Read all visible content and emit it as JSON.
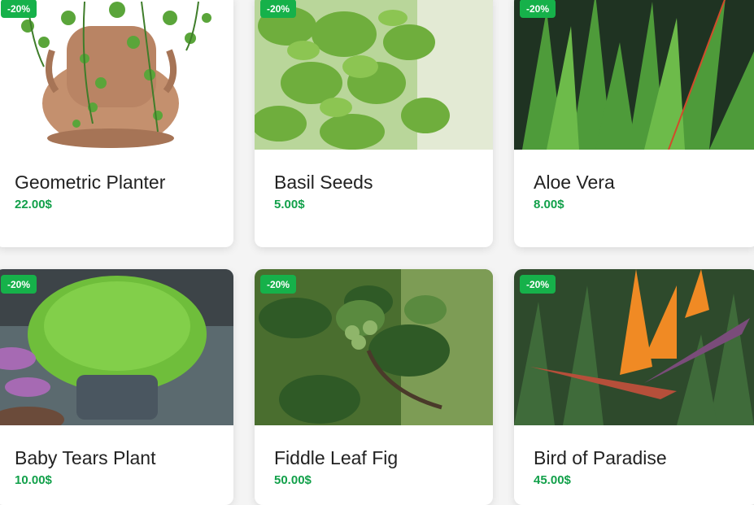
{
  "products": [
    {
      "name": "Geometric Planter",
      "price": "22.00$",
      "badge": "-20%",
      "image_icon": "planter-photo-icon"
    },
    {
      "name": "Basil Seeds",
      "price": "5.00$",
      "badge": "-20%",
      "image_icon": "basil-photo-icon"
    },
    {
      "name": "Aloe Vera",
      "price": "8.00$",
      "badge": "-20%",
      "image_icon": "aloe-photo-icon"
    },
    {
      "name": "Baby Tears Plant",
      "price": "10.00$",
      "badge": "-20%",
      "image_icon": "baby-tears-photo-icon"
    },
    {
      "name": "Fiddle Leaf Fig",
      "price": "50.00$",
      "badge": "-20%",
      "image_icon": "fig-photo-icon"
    },
    {
      "name": "Bird of Paradise",
      "price": "45.00$",
      "badge": "-20%",
      "image_icon": "bird-of-paradise-photo-icon"
    }
  ],
  "colors": {
    "badge": "#16b14a",
    "price": "#12a04a",
    "name": "#222222"
  }
}
